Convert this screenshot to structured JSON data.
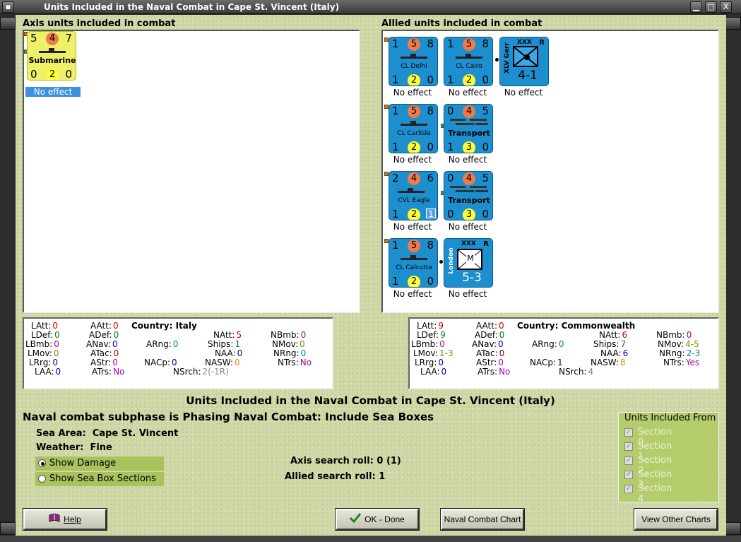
{
  "window": {
    "title": "Units Included in the Naval Combat in Cape St. Vincent (Italy)",
    "minimize": "▁",
    "maximize": "□",
    "close": "X"
  },
  "axis": {
    "heading": "Axis units included in combat",
    "units": [
      {
        "tl": "5",
        "tc": "4",
        "tr": "7",
        "name": "Submarine",
        "bl": "0",
        "bc": "2",
        "br": "0",
        "effect": "No effect"
      }
    ]
  },
  "allied": {
    "heading": "Allied units included in combat",
    "units": [
      {
        "tl": "1",
        "tc": "5",
        "tr": "8",
        "name": "CL Delhi",
        "bl": "1",
        "bc": "2",
        "br": "0",
        "effect": "No effect"
      },
      {
        "tl": "1",
        "tc": "5",
        "tr": "8",
        "name": "CL Cairo",
        "bl": "1",
        "bc": "2",
        "br": "0",
        "effect": "No effect"
      },
      {
        "corps": "XXX",
        "flag": "R",
        "side": "XLV Garr",
        "strength": "4-1",
        "effect": "No effect"
      },
      {
        "tl": "1",
        "tc": "5",
        "tr": "8",
        "name": "CL Carlisle",
        "bl": "1",
        "bc": "2",
        "br": "0",
        "effect": "No effect"
      },
      {
        "tl": "0",
        "tc": "4",
        "tr": "5",
        "name": "Transport",
        "bl": "1",
        "bc": "3",
        "br": "0",
        "effect": "No effect"
      },
      {
        "tl": "2",
        "tc": "4",
        "tr": "6",
        "name": "CVL Eagle",
        "bl": "1",
        "bc": "2",
        "badge": "1",
        "effect": "No effect"
      },
      {
        "tl": "0",
        "tc": "4",
        "tr": "5",
        "name": "Transport",
        "bl": "0",
        "bc": "3",
        "br": "0",
        "effect": "No effect"
      },
      {
        "tl": "1",
        "tc": "5",
        "tr": "8",
        "name": "CL Calcutta",
        "bl": "1",
        "bc": "2",
        "br": "0",
        "effect": "No effect"
      },
      {
        "corps": "XXX",
        "flag": "R",
        "side": "London",
        "letter": "M",
        "strength": "5-3",
        "effect": "No effect"
      }
    ]
  },
  "axis_stats": {
    "country_label": "Country:",
    "country": "Italy",
    "LAtt": "0",
    "LDef": "0",
    "LBmb": "0",
    "LMov": "0",
    "LRrg": "0",
    "LAA": "0",
    "AAtt": "0",
    "ADef": "0",
    "ANav": "0",
    "ATac": "0",
    "AStr": "0",
    "ATrs": "No",
    "ARng": "0",
    "NACp": "0",
    "NAtt": "5",
    "Ships": "1",
    "NAA": "0",
    "NASW": "0",
    "NSrch": "2(-1R)",
    "NBmb": "0",
    "NMov": "0",
    "NRng": "0",
    "NTrs": "No"
  },
  "allied_stats": {
    "country_label": "Country:",
    "country": "Commonwealth",
    "LAtt": "9",
    "LDef": "9",
    "LBmb": "0",
    "LMov": "1-3",
    "LRrg": "0",
    "LAA": "0",
    "AAtt": "0",
    "ADef": "0",
    "ANav": "0",
    "ATac": "0",
    "AStr": "0",
    "ATrs": "No",
    "ARng": "0",
    "NACp": "1",
    "NAtt": "6",
    "Ships": "7",
    "NAA": "6",
    "NASW": "8",
    "NSrch": "4",
    "NBmb": "0",
    "NMov": "4-5",
    "NRng": "2-3",
    "NTrs": "Yes"
  },
  "main_title": "Units Included in the Naval Combat in Cape St. Vincent (Italy)",
  "subphase": "Naval combat subphase is Phasing Naval Combat: Include Sea Boxes",
  "sea_area_label": "Sea Area:",
  "sea_area": "Cape St. Vincent",
  "weather_label": "Weather:",
  "weather": "Fine",
  "show_damage": "Show Damage",
  "show_sections": "Show Sea Box Sections",
  "axis_roll": "Axis search roll: 0 (1)",
  "allied_roll": "Allied search roll: 1",
  "sections": {
    "title": "Units Included From",
    "items": [
      "Section 0",
      "Section 1",
      "Section 2",
      "Section 3",
      "Section 4"
    ]
  },
  "buttons": {
    "help": "Help",
    "ok": "OK - Done",
    "naval_chart": "Naval Combat Chart",
    "other_charts": "View Other Charts"
  },
  "colors": {
    "panel_bg": "#cfd8a6",
    "counter_allied": "#1e8fce",
    "counter_axis": "#eef06a",
    "highlight": "#3d8fe0",
    "section_box": "#b5cc6c"
  }
}
